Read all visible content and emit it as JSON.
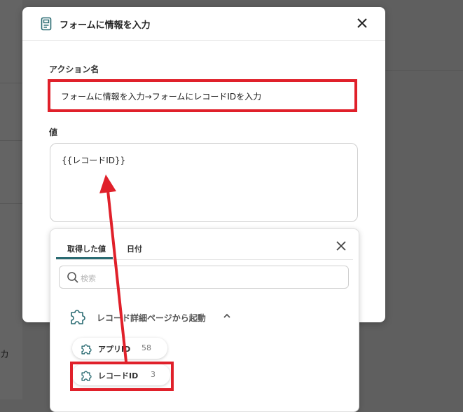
{
  "background": {
    "partial_label": "カ"
  },
  "modal": {
    "title": "フォームに情報を入力",
    "title_icon": "document-icon",
    "close_icon": "close-icon",
    "action_name_label": "アクション名",
    "action_name_value": "フォームに情報を入力→フォームにレコードIDを入力",
    "value_label": "値",
    "value_content": "{{レコードID}}"
  },
  "dropdown": {
    "tabs": [
      {
        "label": "取得した値",
        "active": true
      },
      {
        "label": "日付",
        "active": false
      }
    ],
    "search_placeholder": "検索",
    "group": {
      "label": "レコード詳細ページから起動",
      "expanded": true
    },
    "items": [
      {
        "label": "アプリID",
        "count": "58"
      },
      {
        "label": "レコードID",
        "count": "3"
      }
    ]
  },
  "colors": {
    "highlight": "#e0202a",
    "accent": "#2a6b72",
    "overlay": "#5f5f5f"
  }
}
